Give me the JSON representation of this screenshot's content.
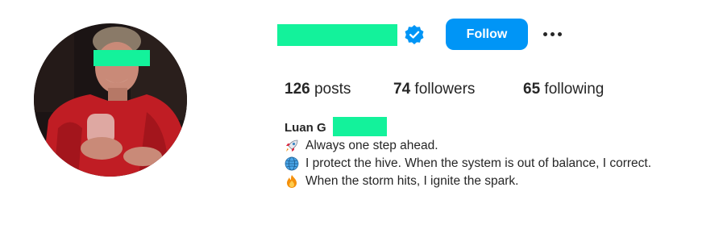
{
  "profile": {
    "follow_label": "Follow",
    "stats": [
      {
        "count": "126",
        "label": "posts"
      },
      {
        "count": "74",
        "label": "followers"
      },
      {
        "count": "65",
        "label": "following"
      }
    ],
    "bio": {
      "name": "Luan G",
      "lines": [
        {
          "emoji": "rocket-icon",
          "text": "Always one step ahead."
        },
        {
          "emoji": "globe-icon",
          "text": "I protect the hive. When the system is out of balance, I correct."
        },
        {
          "emoji": "fire-icon",
          "text": "When the storm hits, I ignite the spark."
        }
      ]
    }
  },
  "colors": {
    "follow_button": "#0095f6",
    "verified_badge": "#0095f6",
    "redaction": "#13f29b",
    "text": "#262626"
  }
}
